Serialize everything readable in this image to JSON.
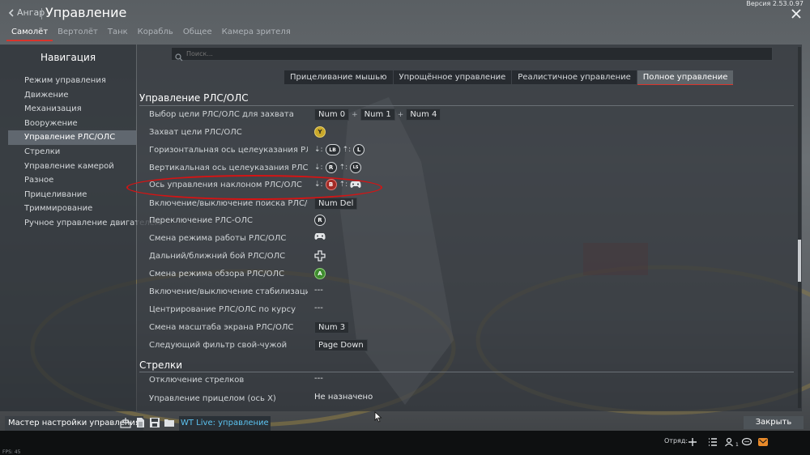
{
  "header": {
    "back_label": "Ангар",
    "title": "Управление",
    "version": "Версия 2.53.0.97"
  },
  "tabs": [
    {
      "label": "Самолёт",
      "active": true
    },
    {
      "label": "Вертолёт",
      "active": false
    },
    {
      "label": "Танк",
      "active": false
    },
    {
      "label": "Корабль",
      "active": false
    },
    {
      "label": "Общее",
      "active": false
    },
    {
      "label": "Камера зрителя",
      "active": false
    }
  ],
  "navigation": {
    "title": "Навигация",
    "items": [
      "Режим управления",
      "Движение",
      "Механизация",
      "Вооружение",
      "Управление РЛС/ОЛС",
      "Стрелки",
      "Управление камерой",
      "Разное",
      "Прицеливание",
      "Триммирование",
      "Ручное управление двигателем"
    ],
    "active_index": 4
  },
  "search": {
    "placeholder": "Поиск..."
  },
  "modes": [
    {
      "label": "Прицеливание мышью",
      "active": false
    },
    {
      "label": "Упрощённое управление",
      "active": false
    },
    {
      "label": "Реалистичное управление",
      "active": false
    },
    {
      "label": "Полное управление",
      "active": true
    }
  ],
  "sections": [
    {
      "title": "Управление РЛС/ОЛС",
      "rows": [
        {
          "label": "Выбор цели РЛС/ОЛС для захвата",
          "keys": [
            "Num 0",
            "Num 1",
            "Num 4"
          ]
        },
        {
          "label": "Захват цели РЛС/ОЛС",
          "gamepad": "Y"
        },
        {
          "label": "Горизонтальная ось целеуказания РЛС/ОЛС",
          "axis": [
            "⇣:",
            "LB",
            "⇡:",
            "L"
          ]
        },
        {
          "label": "Вертикальная ось целеуказания РЛС/ОЛС",
          "axis": [
            "⇣:",
            "R",
            "⇡:",
            "LS"
          ]
        },
        {
          "label": "Ось управления наклоном РЛС/ОЛС",
          "axis": [
            "⇣:",
            "B",
            "⇡:",
            "gamepad"
          ]
        },
        {
          "label": "Включение/выключение поиска РЛС/ОЛС",
          "keys": [
            "Num Del"
          ]
        },
        {
          "label": "Переключение РЛС-ОЛС",
          "gamepad": "R"
        },
        {
          "label": "Смена режима работы РЛС/ОЛС",
          "icon": "gamepad-icon"
        },
        {
          "label": "Дальний/ближний бой РЛС/ОЛС",
          "icon": "dpad-icon"
        },
        {
          "label": "Смена режима обзора РЛС/ОЛС",
          "gamepad": "A"
        },
        {
          "label": "Включение/выключение стабилизации РЛС/ОЛС",
          "text": "---"
        },
        {
          "label": "Центрирование РЛС/ОЛС по курсу",
          "text": "---"
        },
        {
          "label": "Смена масштаба экрана РЛС/ОЛС",
          "keys": [
            "Num 3"
          ]
        },
        {
          "label": "Следующий фильтр свой-чужой",
          "keys": [
            "Page Down"
          ]
        }
      ]
    },
    {
      "title": "Стрелки",
      "rows": [
        {
          "label": "Отключение стрелков",
          "text": "---"
        },
        {
          "label": "Управление прицелом (ось X)",
          "text": "Не назначено"
        }
      ]
    }
  ],
  "bottom": {
    "master_label": "Мастер настройки управления",
    "wt_live_label": "WT Live: управление",
    "close_label": "Закрыть"
  },
  "footer": {
    "fps": "FPS: 45",
    "squad_label": "Отряд:",
    "squad_count": "1"
  },
  "colors": {
    "accent_red": "#d9342b",
    "link_blue": "#5cc3f0",
    "annotation_red": "#d41414"
  }
}
